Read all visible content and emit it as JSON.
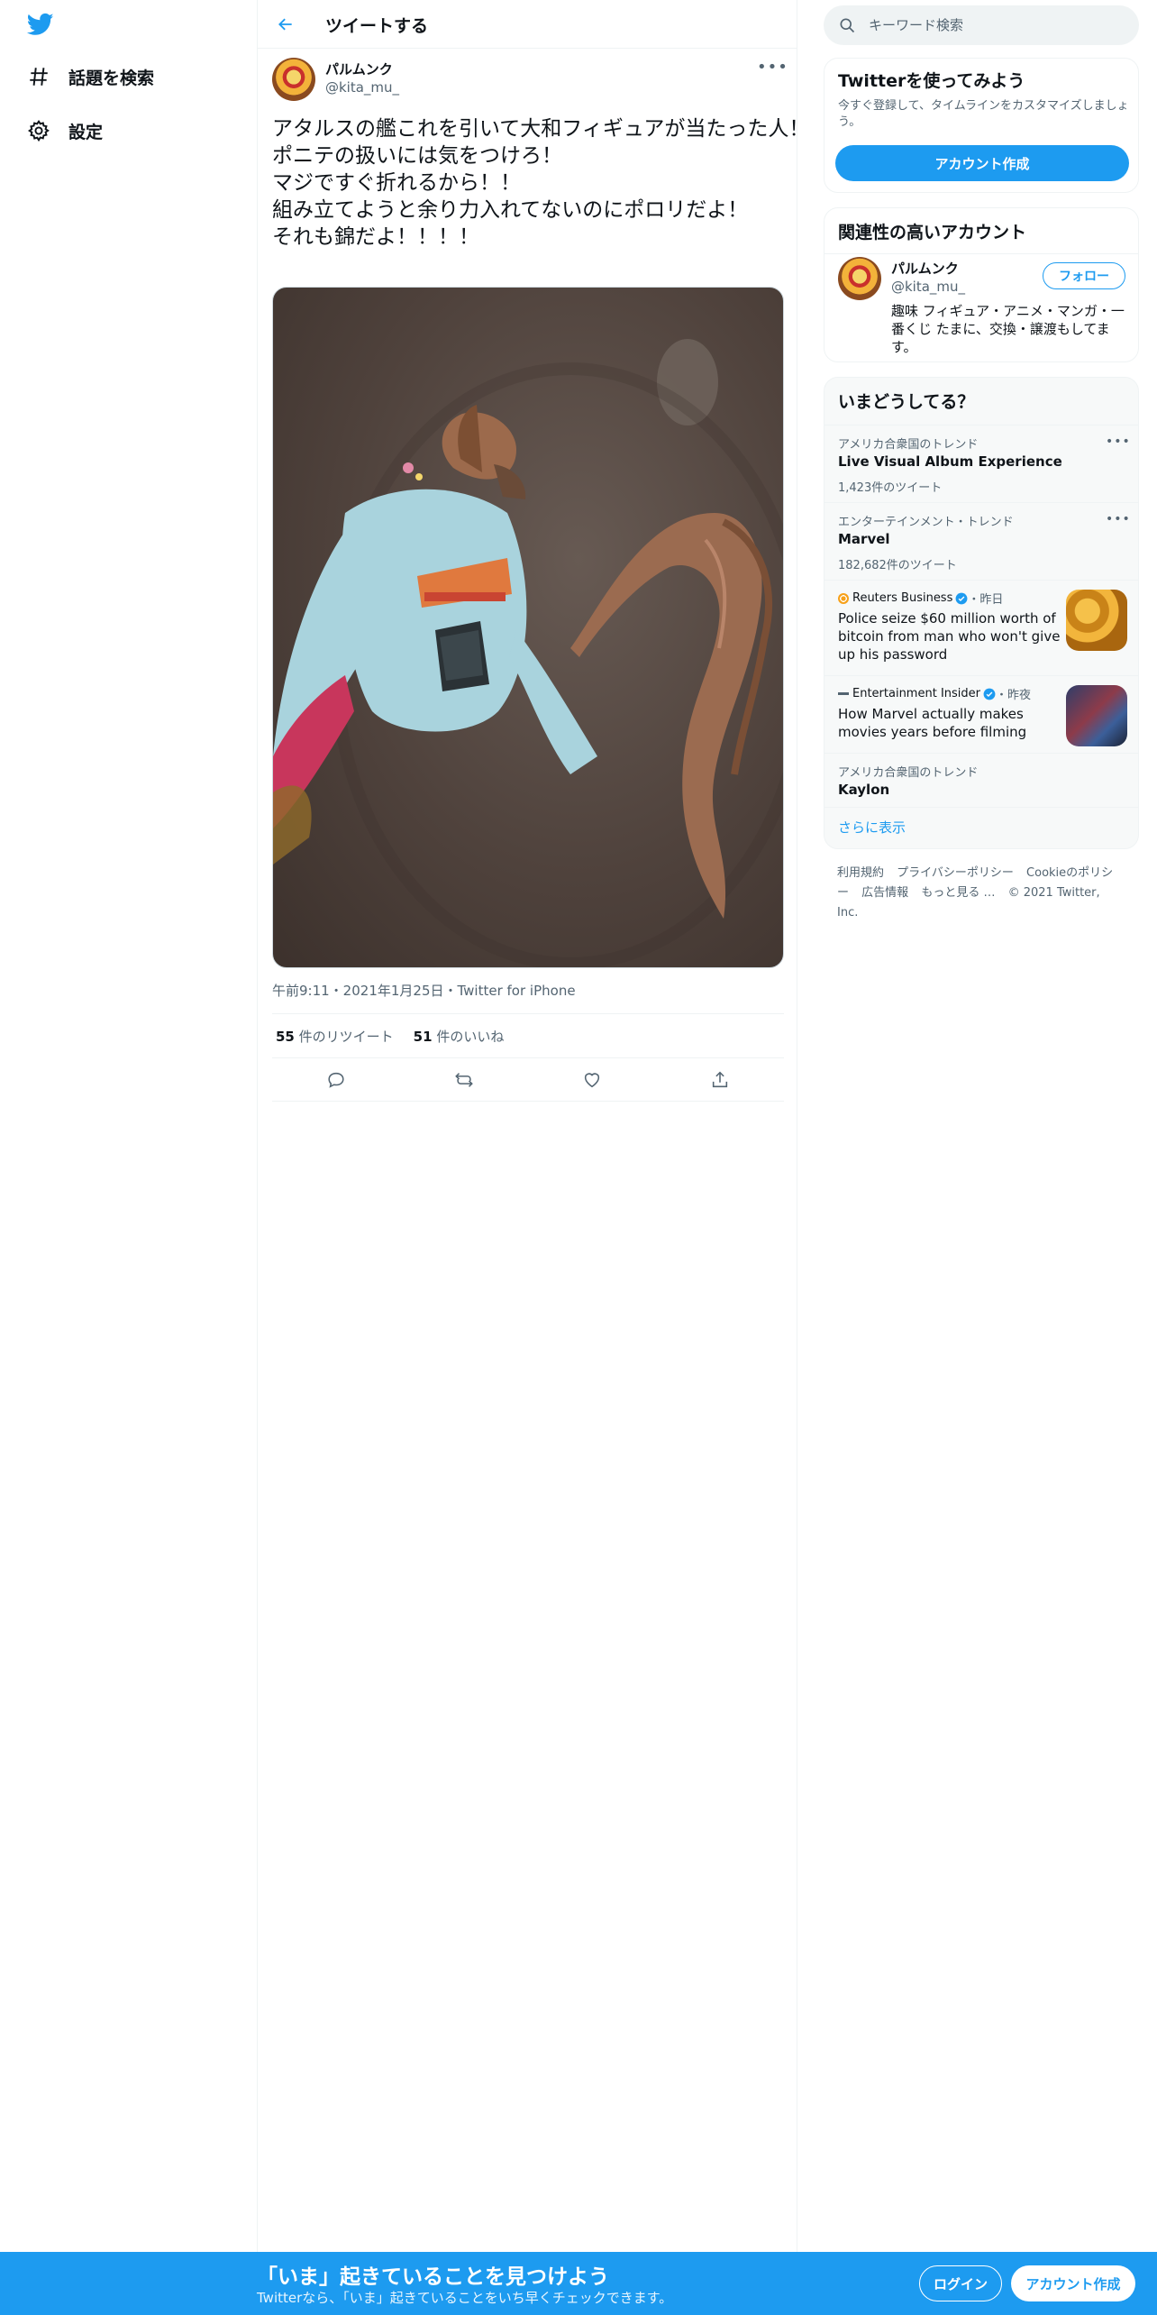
{
  "nav": {
    "items": [
      {
        "icon": "hashtag-icon",
        "label": "話題を検索"
      },
      {
        "icon": "gear-icon",
        "label": "設定"
      }
    ]
  },
  "header": {
    "title": "ツイートする"
  },
  "tweet": {
    "author_name": "パルムンク",
    "author_handle": "@kita_mu_",
    "text_lines": [
      "アタルスの艦これを引いて大和フィギュアが当たった人！",
      "ポニテの扱いには気をつけろ！",
      "マジですぐ折れるから！！",
      "組み立てようと余り力入れてないのにポロリだよ！",
      "それも錦だよ！！！！"
    ],
    "meta": "午前9:11・2021年1月25日・Twitter for iPhone",
    "retweets_count": "55",
    "retweets_label": "件のリツイート",
    "likes_count": "51",
    "likes_label": "件のいいね"
  },
  "search": {
    "placeholder": "キーワード検索"
  },
  "signup_card": {
    "title": "Twitterを使ってみよう",
    "description": "今すぐ登録して、タイムラインをカスタマイズしましょう。",
    "button": "アカウント作成"
  },
  "related": {
    "title": "関連性の高いアカウント",
    "name": "パルムンク",
    "handle": "@kita_mu_",
    "follow_label": "フォロー",
    "bio": "趣味 フィギュア・アニメ・マンガ・一番くじ たまに、交換・譲渡もしてます。"
  },
  "trends": {
    "title": "いまどうしてる？",
    "items": [
      {
        "category": "アメリカ合衆国のトレンド",
        "name": "Live Visual Album Experience",
        "count": "1,423件のツイート"
      },
      {
        "category": "エンターテインメント・トレンド",
        "name": "Marvel",
        "count": "182,682件のツイート"
      },
      {
        "category": "アメリカ合衆国のトレンド",
        "name": "Kaylon"
      }
    ],
    "news": [
      {
        "source": "Reuters Business",
        "time": "・昨日",
        "title": "Police seize $60 million worth of bitcoin from man who won't give up his password"
      },
      {
        "source": "Entertainment Insider",
        "time": "・昨夜",
        "title": "How Marvel actually makes movies years before filming"
      }
    ],
    "show_more": "さらに表示"
  },
  "footer": {
    "links": [
      "利用規約",
      "プライバシーポリシー",
      "Cookieのポリシー",
      "広告情報",
      "もっと見る …"
    ],
    "copyright": "© 2021 Twitter, Inc."
  },
  "bottom_bar": {
    "title": "「いま」起きていることを見つけよう",
    "subtitle": "Twitterなら、「いま」起きていることをいち早くチェックできます。",
    "login": "ログイン",
    "signup": "アカウント作成"
  },
  "colors": {
    "accent": "#1d9bf0",
    "text": "#0f1419",
    "secondary": "#536471"
  }
}
